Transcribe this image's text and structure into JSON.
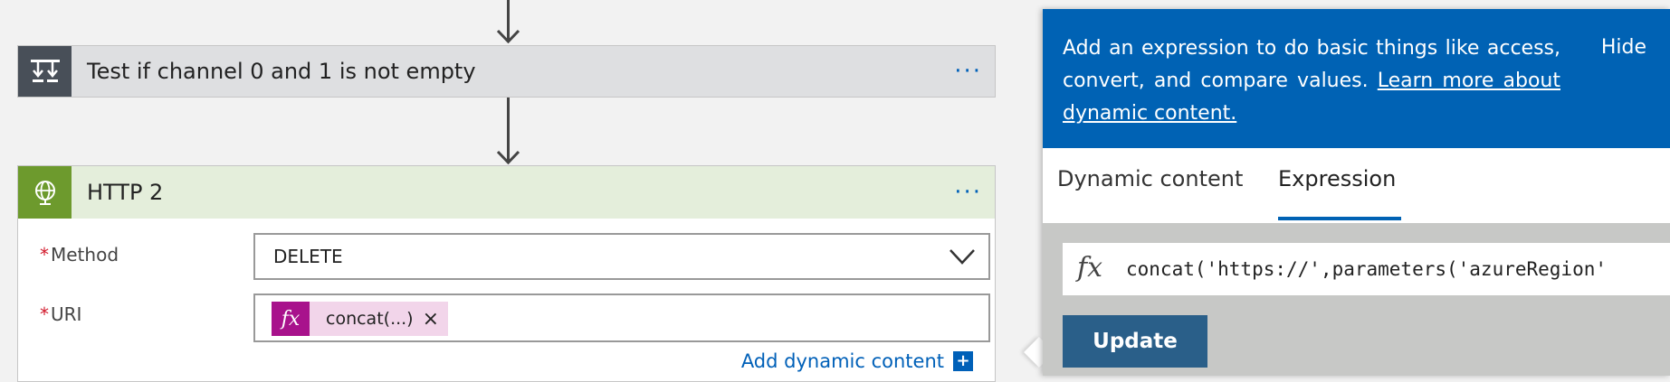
{
  "flow": {
    "condition_step": {
      "title": "Test if channel 0 and 1 is not empty",
      "more_label": "···"
    },
    "http_step": {
      "title": "HTTP 2",
      "more_label": "···",
      "method": {
        "required_mark": "*",
        "label": "Method",
        "value": "DELETE"
      },
      "uri": {
        "required_mark": "*",
        "label": "URI",
        "token_icon": "fx",
        "token_text": "concat(...)",
        "token_remove": "×"
      },
      "add_dynamic_label": "Add dynamic content",
      "add_dynamic_plus": "+"
    }
  },
  "panel": {
    "info_text": "Add an expression to do basic things like access, convert, and compare values.",
    "info_link": "Learn more about dynamic content.",
    "hide_label": "Hide",
    "tabs": [
      {
        "label": "Dynamic content",
        "active": false
      },
      {
        "label": "Expression",
        "active": true
      }
    ],
    "fx_symbol": "fx",
    "expression_value": "concat('https://',parameters('azureRegion'",
    "update_label": "Update"
  },
  "colors": {
    "accent_blue": "#0062b4",
    "condition_icon_bg": "#484f58",
    "http_icon_bg": "#6d9a2d",
    "token_bg": "#a8128c",
    "update_button": "#2a5f89"
  },
  "icons": {
    "condition": "condition-split-icon",
    "http": "globe-icon",
    "dropdown": "chevron-down-icon"
  }
}
